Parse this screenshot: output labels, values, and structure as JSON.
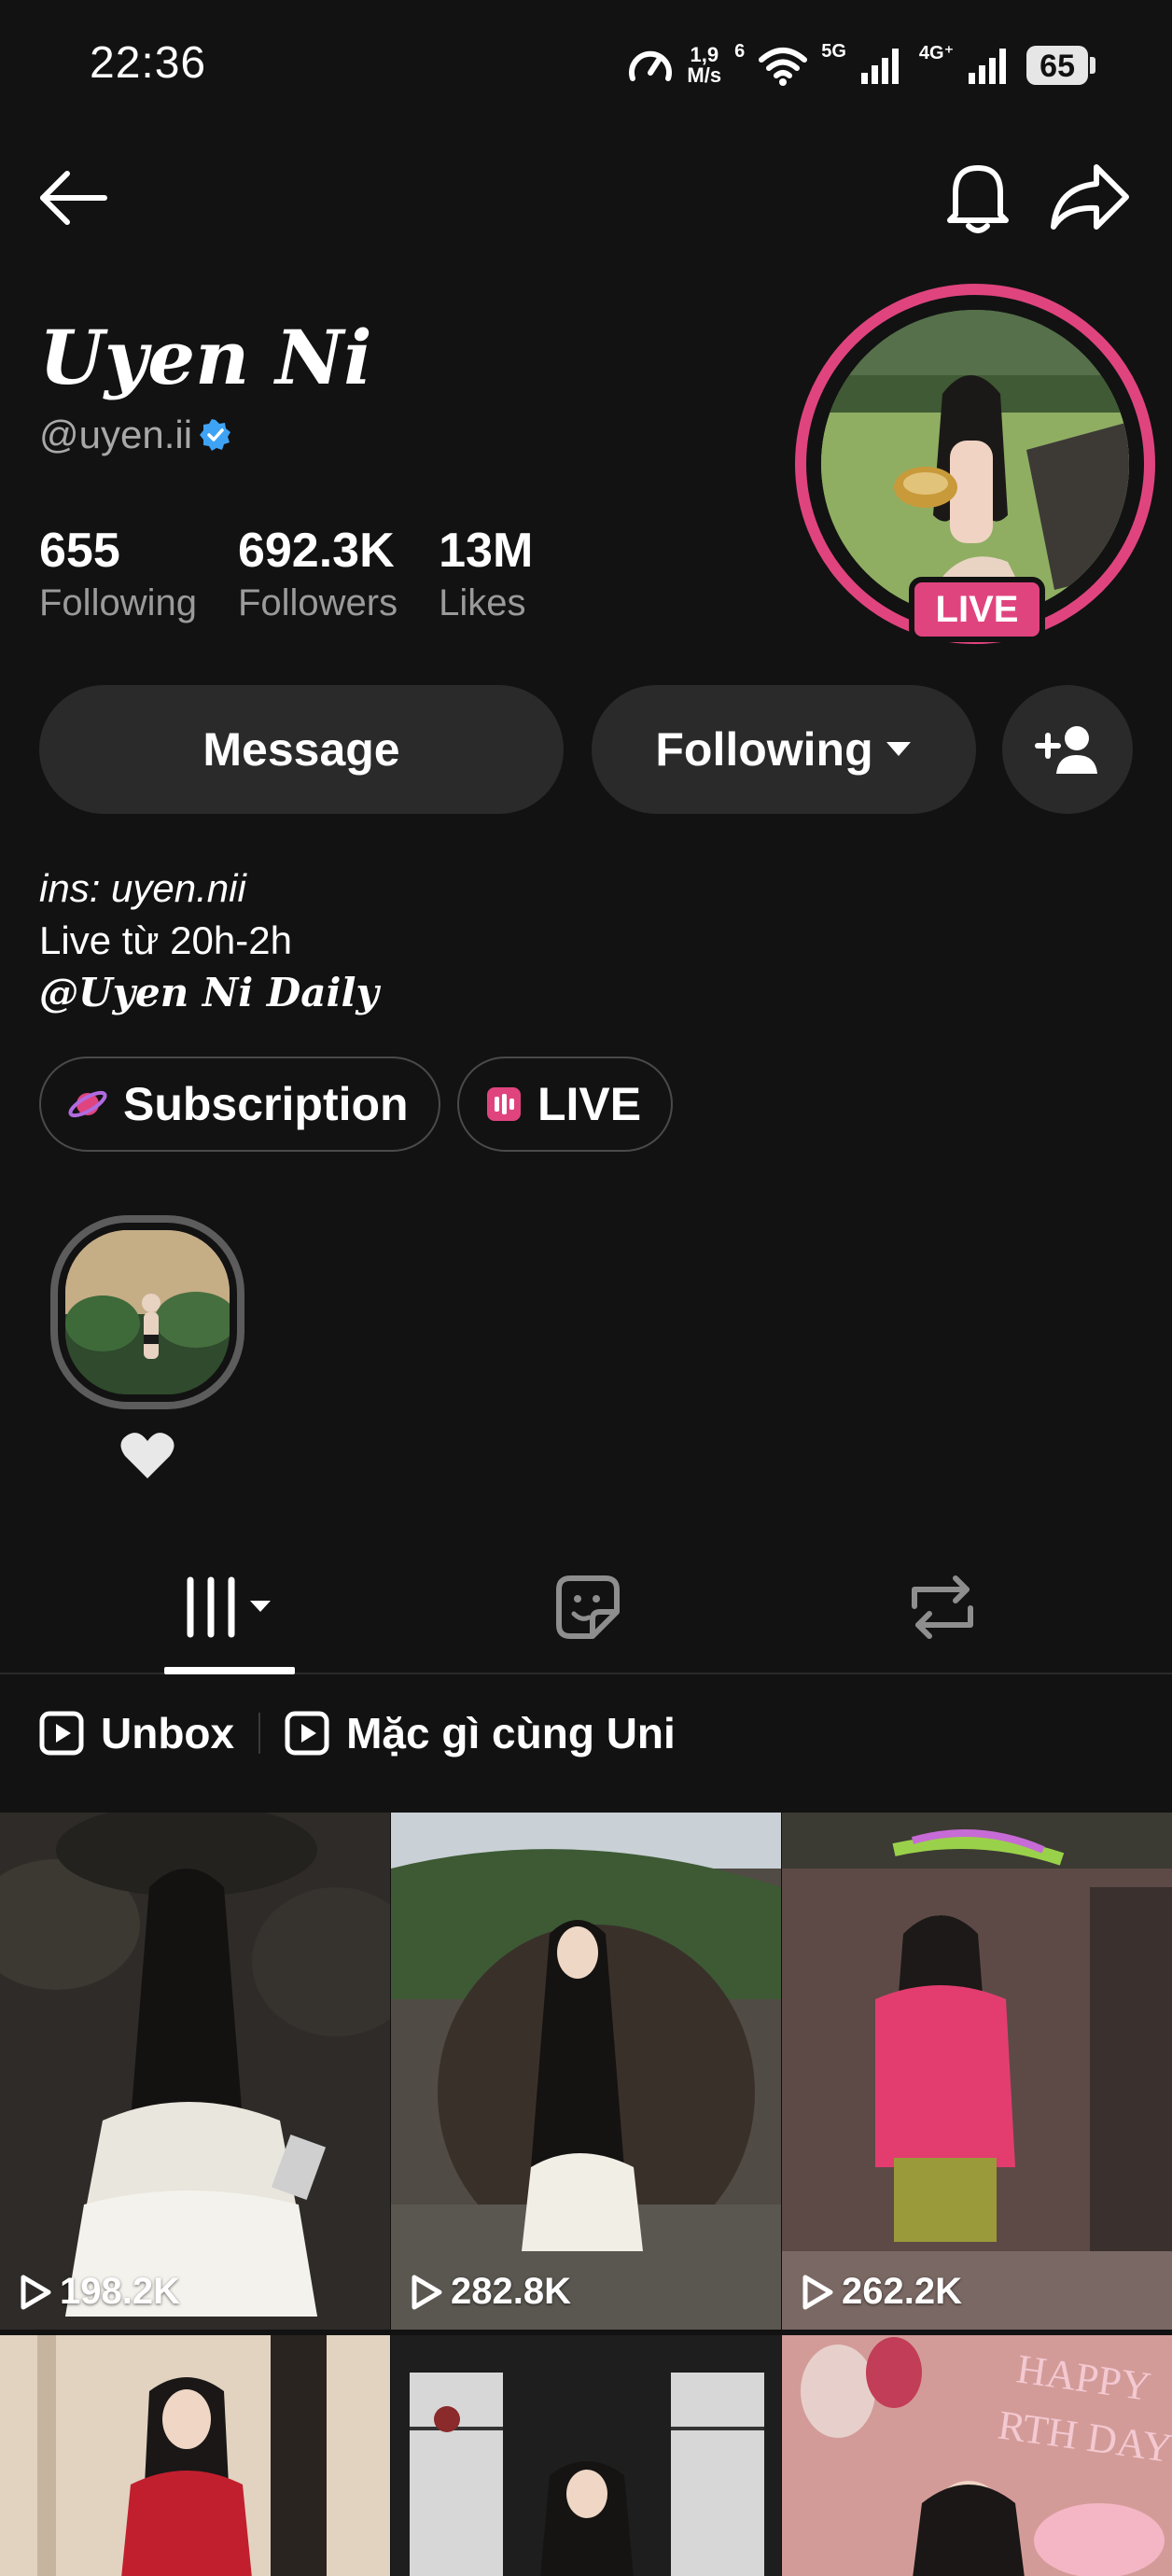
{
  "status_bar": {
    "time": "22:36",
    "speed_value": "1,9",
    "speed_unit": "M/s",
    "wifi_badge": "6",
    "net1": "5G",
    "net2": "4G⁺",
    "battery": "65"
  },
  "header": {
    "back_icon": "arrow-left-icon",
    "bell_icon": "bell-icon",
    "share_icon": "share-icon"
  },
  "profile": {
    "display_name": "Uyen Ni",
    "handle": "@uyen.ii",
    "live_badge": "LIVE",
    "stats": [
      {
        "value": "655",
        "label": "Following"
      },
      {
        "value": "692.3K",
        "label": "Followers"
      },
      {
        "value": "13M",
        "label": "Likes"
      }
    ]
  },
  "actions": {
    "message": "Message",
    "following": "Following"
  },
  "bio": {
    "ins_label": "ins",
    "ins_value": ": uyen.nii",
    "line2": "Live từ 20h-2h",
    "mention": "@Uyen Ni Daily"
  },
  "chips": {
    "subscription": "Subscription",
    "live": "LIVE"
  },
  "playlists": [
    {
      "label": "Unbox"
    },
    {
      "label": "Mặc gì cùng Uni"
    }
  ],
  "videos": [
    {
      "views": "198.2K",
      "bg": "#2c2a27"
    },
    {
      "views": "282.8K",
      "bg": "#4a4740"
    },
    {
      "views": "262.2K",
      "bg": "#6b4b48"
    },
    {
      "views": "",
      "bg": "#d9c6b0"
    },
    {
      "views": "",
      "bg": "#2a2a2a"
    },
    {
      "views": "",
      "bg": "#c98a8a"
    }
  ],
  "colors": {
    "accent_pink": "#e0447e",
    "background": "#121212",
    "button_bg": "#2a2a2a",
    "verified_blue": "#3fa3f5"
  }
}
